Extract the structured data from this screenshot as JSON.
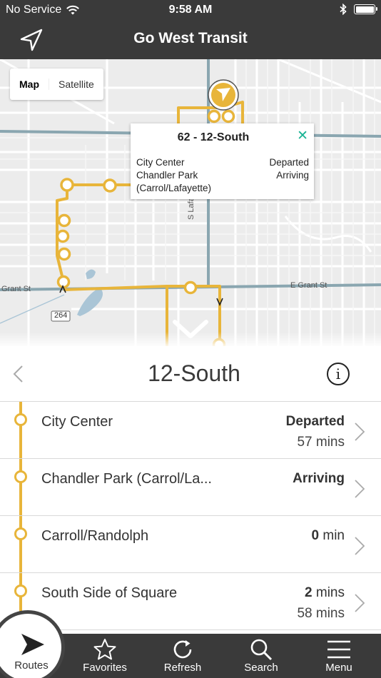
{
  "status_bar": {
    "carrier": "No Service",
    "time": "9:58 AM"
  },
  "header": {
    "title": "Go West Transit",
    "left_icon": "navigation-arrow-icon"
  },
  "map": {
    "toggle": {
      "map_label": "Map",
      "satellite_label": "Satellite",
      "selected": "Map"
    },
    "popup": {
      "title": "62 - 12-South",
      "rows": [
        {
          "stop": "City Center",
          "status": "Departed"
        },
        {
          "stop": "Chandler Park\n(Carrol/Lafayette)",
          "status": "Arriving"
        }
      ]
    },
    "labels": {
      "grant_st_w": "Grant St",
      "grant_st_e": "E Grant St",
      "lafayette": "S Lafayette",
      "highway": "264"
    },
    "colors": {
      "route": "#e8b53a",
      "highway": "#8aa6b0",
      "close_icon": "#1ab394"
    }
  },
  "route": {
    "title": "12-South",
    "stops": [
      {
        "name": "City Center",
        "status_bold": "Departed",
        "status_unit": "",
        "eta": "57 mins"
      },
      {
        "name": "Chandler Park (Carrol/La...",
        "status_bold": "Arriving",
        "status_unit": "",
        "eta": ""
      },
      {
        "name": "Carroll/Randolph",
        "status_bold": "0",
        "status_unit": " min",
        "eta": ""
      },
      {
        "name": "South Side of Square",
        "status_bold": "2",
        "status_unit": " mins",
        "eta": "58 mins"
      }
    ]
  },
  "tabs": {
    "routes": "Routes",
    "favorites": "Favorites",
    "refresh": "Refresh",
    "search": "Search",
    "menu": "Menu"
  }
}
